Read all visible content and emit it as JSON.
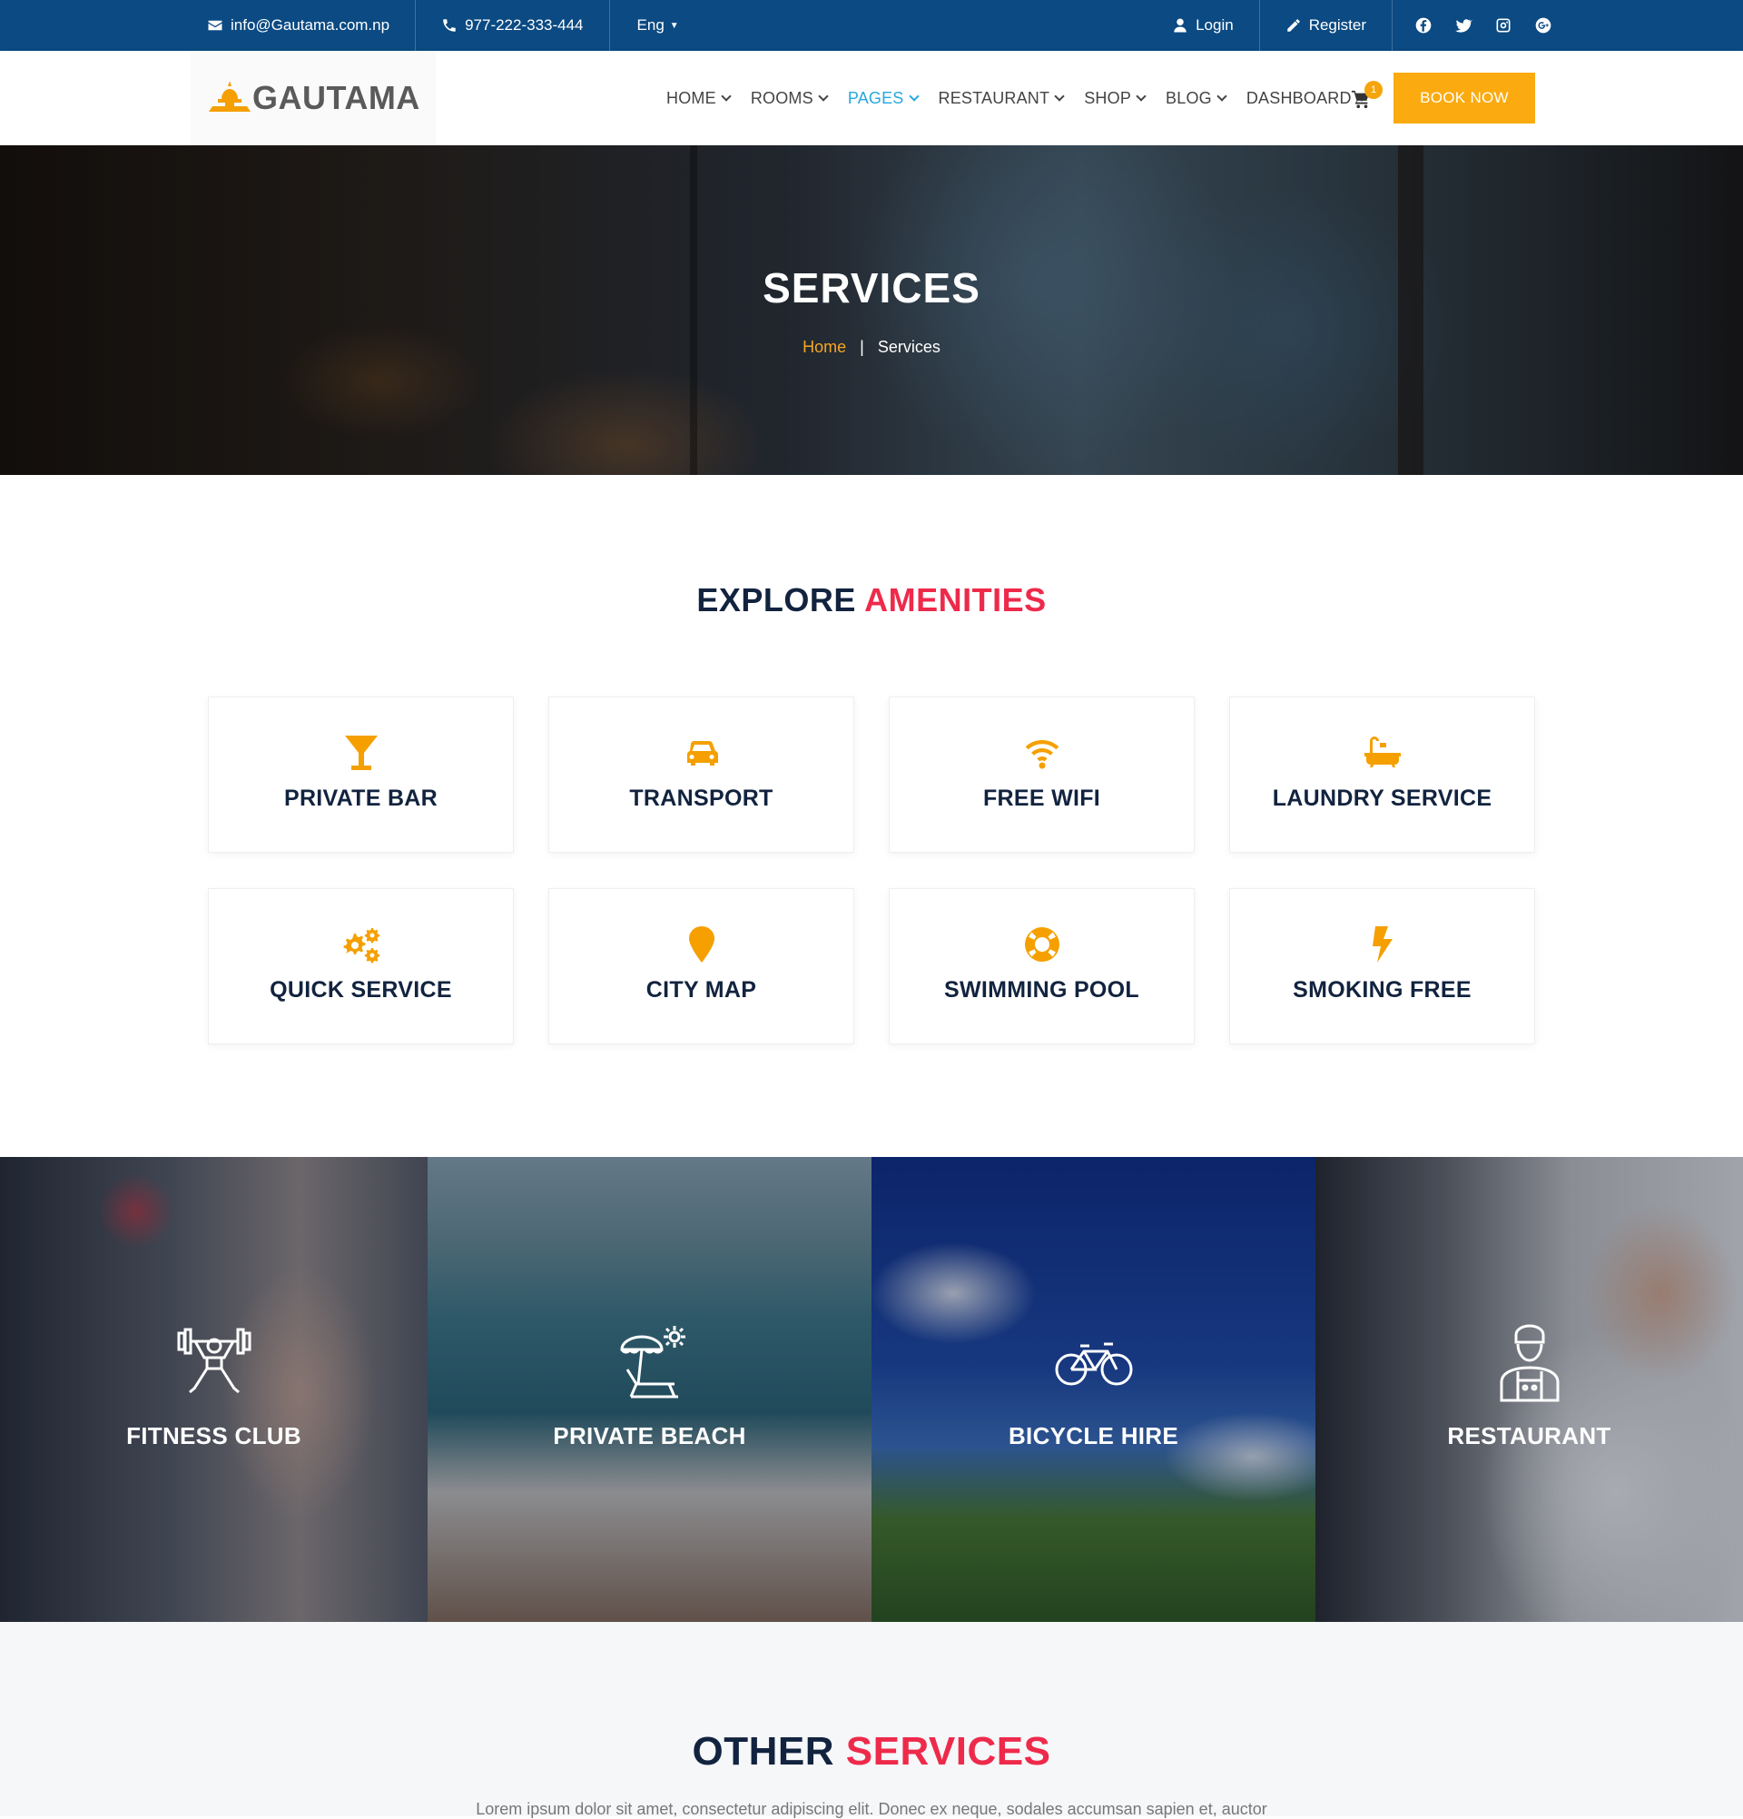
{
  "topbar": {
    "email": "info@Gautama.com.np",
    "phone": "977-222-333-444",
    "language": "Eng",
    "login": "Login",
    "register": "Register",
    "social_icons": [
      "facebook-icon",
      "twitter-icon",
      "instagram-icon",
      "google-plus-icon"
    ]
  },
  "header": {
    "logo": "GAUTAMA",
    "nav": [
      {
        "label": "HOME",
        "active": false
      },
      {
        "label": "ROOMS",
        "active": false
      },
      {
        "label": "PAGES",
        "active": true
      },
      {
        "label": "RESTAURANT",
        "active": false
      },
      {
        "label": "SHOP",
        "active": false
      },
      {
        "label": "BLOG",
        "active": false
      },
      {
        "label": "DASHBOARD",
        "active": false
      }
    ],
    "cart_count": "1",
    "book_now": "BOOK NOW"
  },
  "hero": {
    "title": "SERVICES",
    "breadcrumb_home": "Home",
    "breadcrumb_sep": "|",
    "breadcrumb_current": "Services"
  },
  "amenities": {
    "title_main": "EXPLORE",
    "title_accent": "AMENITIES",
    "items": [
      {
        "label": "PRIVATE BAR",
        "icon": "cocktail-icon"
      },
      {
        "label": "TRANSPORT",
        "icon": "car-icon"
      },
      {
        "label": "FREE WIFI",
        "icon": "wifi-icon"
      },
      {
        "label": "LAUNDRY SERVICE",
        "icon": "bathtub-icon"
      },
      {
        "label": "QUICK SERVICE",
        "icon": "gears-icon"
      },
      {
        "label": "CITY MAP",
        "icon": "map-marker-icon"
      },
      {
        "label": "SWIMMING POOL",
        "icon": "life-ring-icon"
      },
      {
        "label": "SMOKING FREE",
        "icon": "bolt-icon"
      }
    ]
  },
  "features": [
    {
      "label": "FITNESS CLUB",
      "icon": "weightlifter-icon"
    },
    {
      "label": "PRIVATE BEACH",
      "icon": "beach-chair-icon"
    },
    {
      "label": "BICYCLE HIRE",
      "icon": "bicycle-icon"
    },
    {
      "label": "RESTAURANT",
      "icon": "chef-icon"
    }
  ],
  "other_services": {
    "title_main": "OTHER",
    "title_accent": "SERVICES",
    "text": "Lorem ipsum dolor sit amet, consectetur adipiscing elit. Donec ex neque, sodales accumsan sapien et, auctor"
  },
  "colors": {
    "topbar": "#0b4a82",
    "accent_orange": "#fbaa0f",
    "accent_red": "#ee2a4b",
    "nav_active": "#28a7e0",
    "heading_navy": "#12233f"
  }
}
